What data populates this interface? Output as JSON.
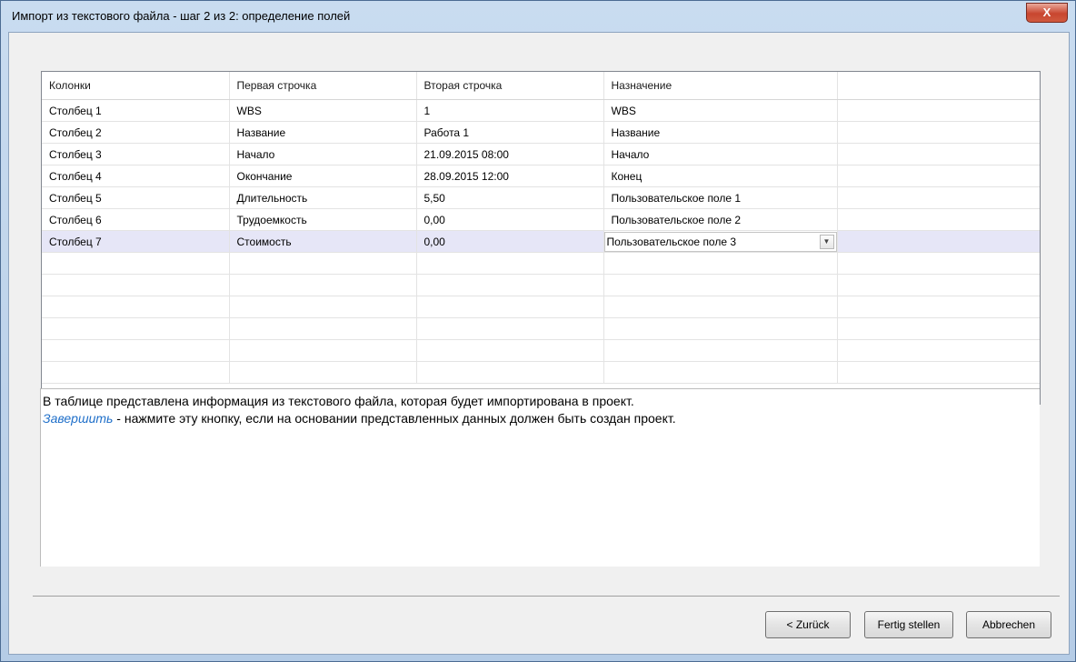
{
  "window": {
    "title": "Импорт из текстового файла - шаг 2 из 2: определение полей",
    "close_glyph": "X"
  },
  "grid": {
    "headers": [
      "Колонки",
      "Первая строчка",
      "Вторая строчка",
      "Назначение",
      ""
    ],
    "rows": [
      [
        "Столбец 1",
        "WBS",
        "1",
        "WBS"
      ],
      [
        "Столбец 2",
        "Название",
        "Работа 1",
        "Название"
      ],
      [
        "Столбец 3",
        "Начало",
        "21.09.2015 08:00",
        "Начало"
      ],
      [
        "Столбец 4",
        "Окончание",
        "28.09.2015 12:00",
        "Конец"
      ],
      [
        "Столбец 5",
        "Длительность",
        "5,50",
        "Пользовательское поле 1"
      ],
      [
        "Столбец 6",
        "Трудоемкость",
        "0,00",
        "Пользовательское поле 2"
      ],
      [
        "Столбец 7",
        "Стоимость",
        "0,00",
        "Пользовательское поле 3"
      ]
    ],
    "selected_row": 6
  },
  "info": {
    "line1": "В таблице представлена информация из текстового файла, которая будет импортирована в проект.",
    "link_text": "Завершить",
    "line2_rest": " - нажмите эту кнопку, если на основании представленных данных должен быть создан проект."
  },
  "buttons": {
    "back": "< Zurück",
    "finish": "Fertig stellen",
    "cancel": "Abbrechen"
  },
  "colors": {
    "link": "#1f6fc9",
    "selected_row": "#e6e6f7",
    "close_button": "#c8462f"
  }
}
